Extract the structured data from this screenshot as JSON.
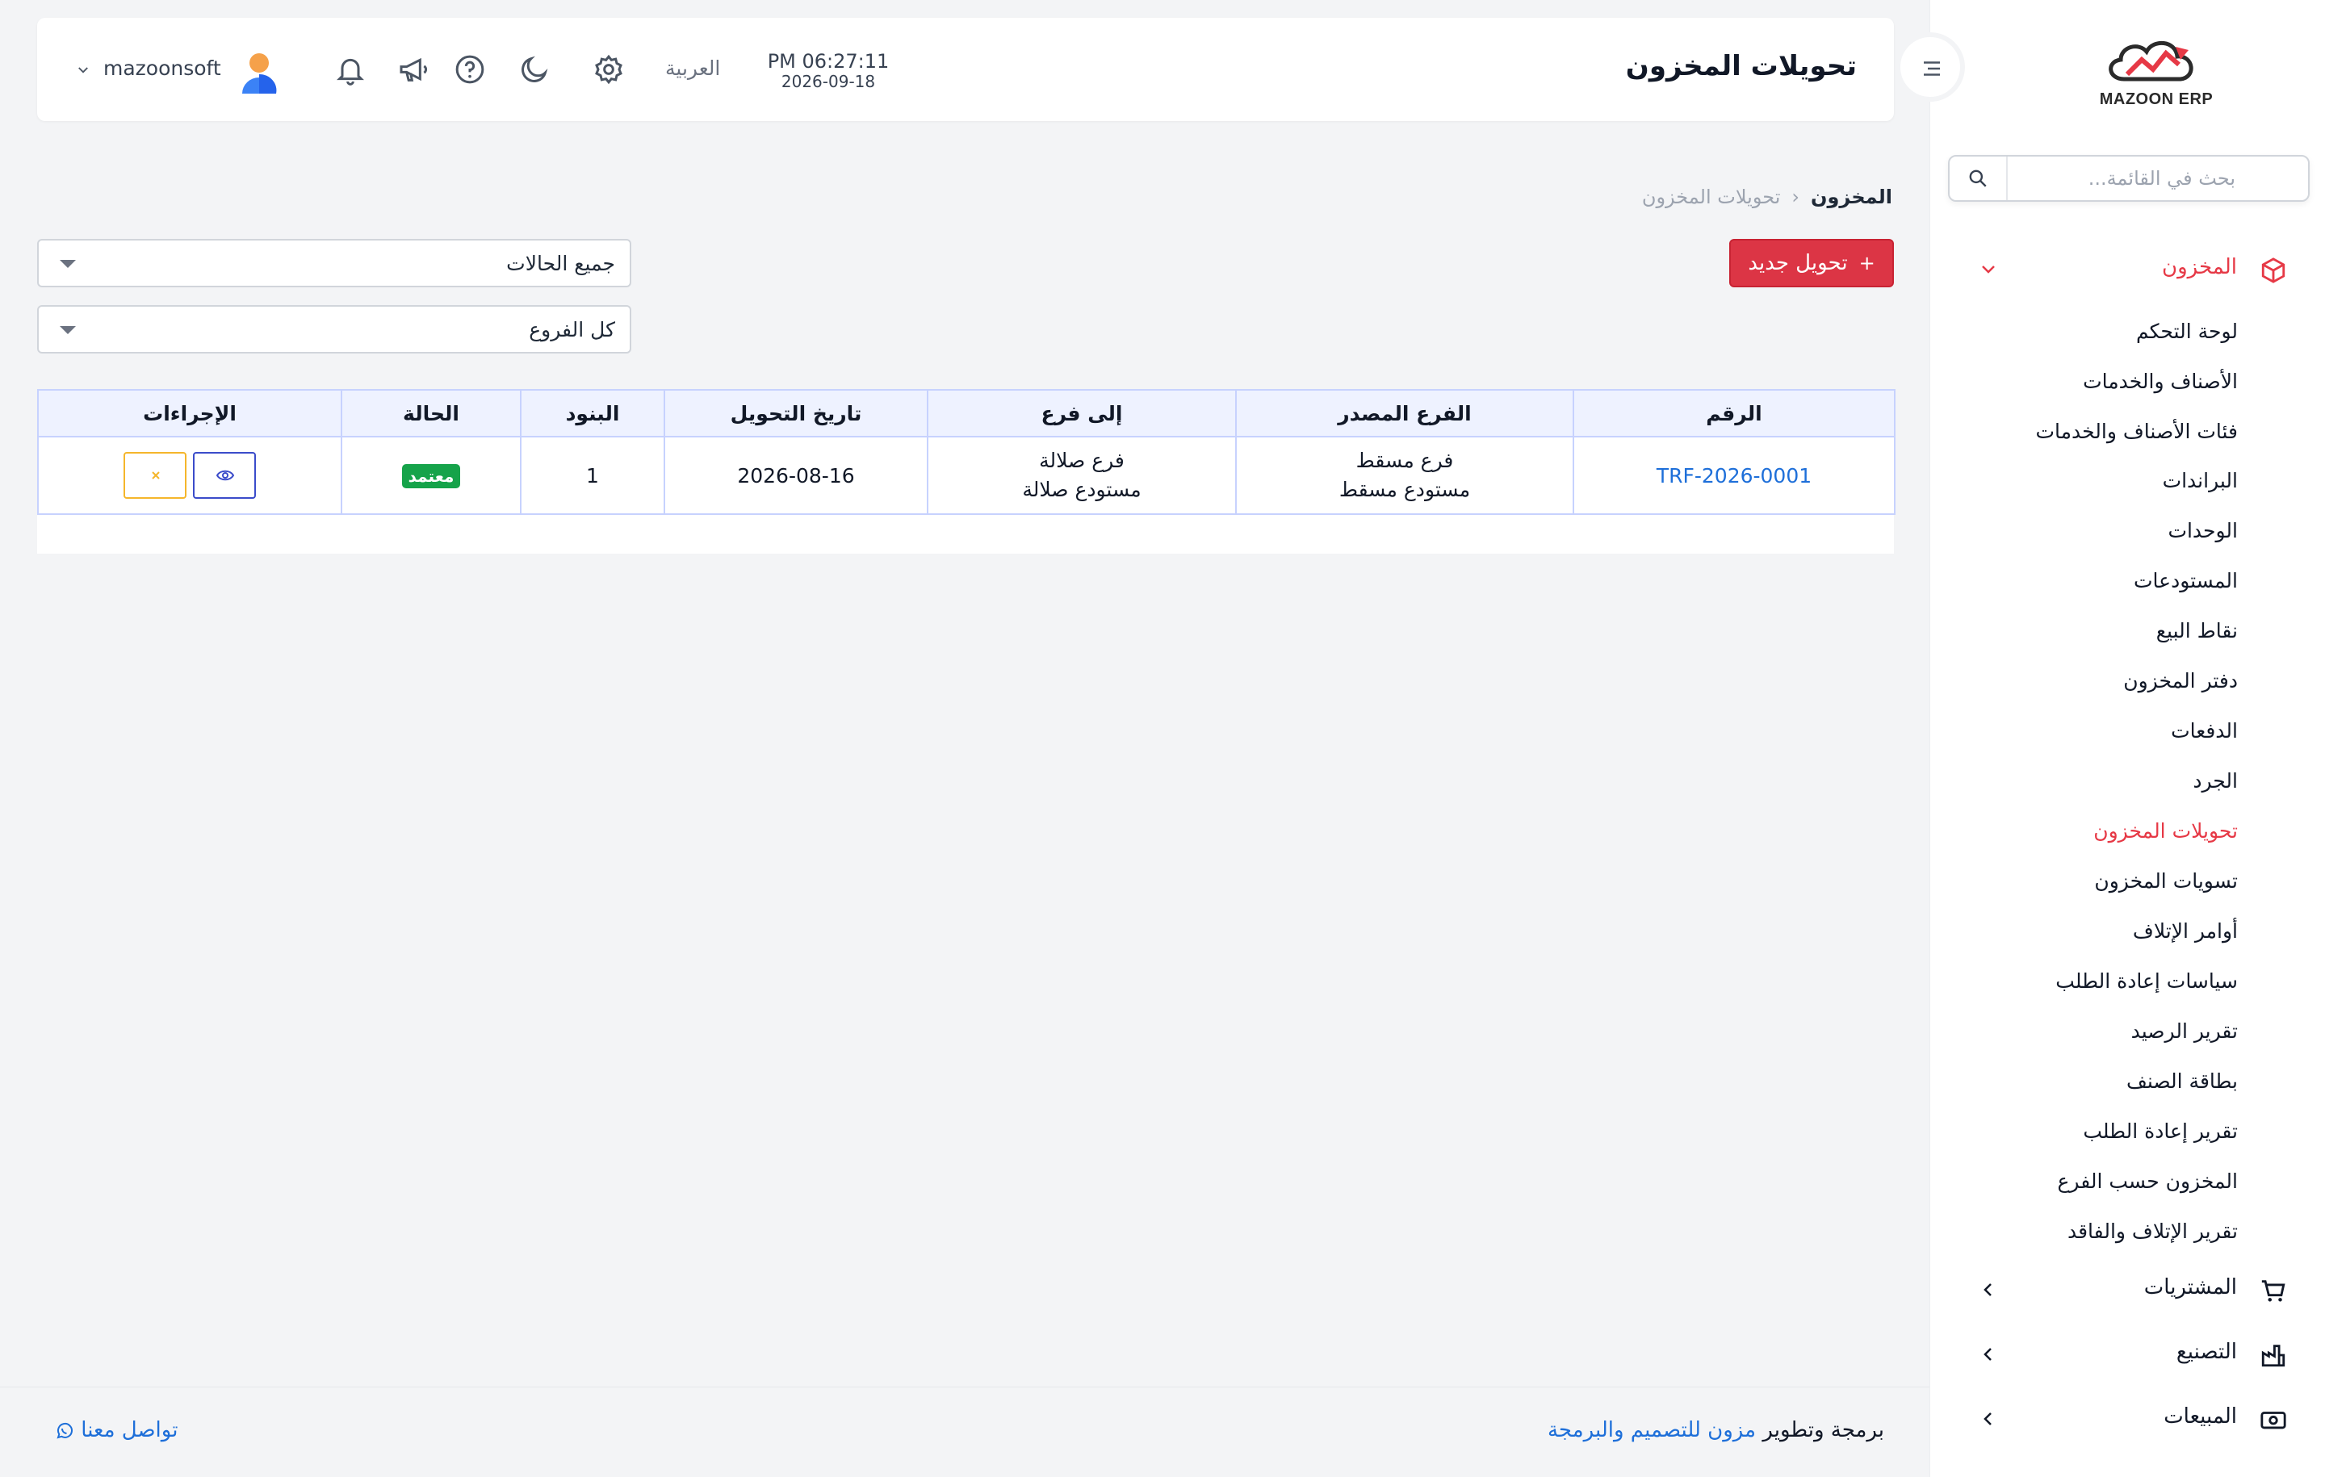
{
  "sidebar": {
    "logo_text": "MAZOON ERP",
    "search_placeholder": "بحث في القائمة...",
    "groups": [
      {
        "label": "المخزون",
        "icon": "box-icon"
      },
      {
        "label": "المشتريات",
        "icon": "cart-icon"
      },
      {
        "label": "التصنيع",
        "icon": "factory-icon"
      },
      {
        "label": "المبيعات",
        "icon": "cash-icon"
      }
    ],
    "inventory_items": [
      "لوحة التحكم",
      "الأصناف والخدمات",
      "فئات الأصناف والخدمات",
      "البراندات",
      "الوحدات",
      "المستودعات",
      "نقاط البيع",
      "دفتر المخزون",
      "الدفعات",
      "الجرد",
      "تحويلات المخزون",
      "تسويات المخزون",
      "أوامر الإتلاف",
      "سياسات إعادة الطلب",
      "تقرير الرصيد",
      "بطاقة الصنف",
      "تقرير إعادة الطلب",
      "المخزون حسب الفرع",
      "تقرير الإتلاف والفاقد"
    ],
    "active_item": "تحويلات المخزون"
  },
  "header": {
    "title": "تحويلات المخزون",
    "time": "PM 06:27:11",
    "date": "2026-09-18",
    "language": "العربية",
    "username": "mazoonsoft"
  },
  "breadcrumb": {
    "root": "المخزون",
    "current": "تحويلات المخزون"
  },
  "toolbar": {
    "new_transfer_label": "تحويل جديد",
    "status_filter": "جميع الحالات",
    "branch_filter": "كل الفروع"
  },
  "table": {
    "headers": [
      "الرقم",
      "الفرع المصدر",
      "إلى فرع",
      "تاريخ التحويل",
      "البنود",
      "الحالة",
      "الإجراءات"
    ],
    "rows": [
      {
        "number": "TRF-2026-0001",
        "source_branch": "فرع مسقط",
        "source_warehouse": "مستودع مسقط",
        "dest_branch": "فرع صلالة",
        "dest_warehouse": "مستودع صلالة",
        "date": "2026-08-16",
        "items": "1",
        "status": "معتمد"
      }
    ]
  },
  "footer": {
    "credit_prefix": "برمجة وتطوير",
    "credit_brand": "مزون للتصميم والبرمجة",
    "contact": "تواصل معنا"
  },
  "colors": {
    "accent": "#e63946",
    "primary_button": "#dc3545",
    "link": "#1e6fd9",
    "status_approved": "#16a34a"
  }
}
